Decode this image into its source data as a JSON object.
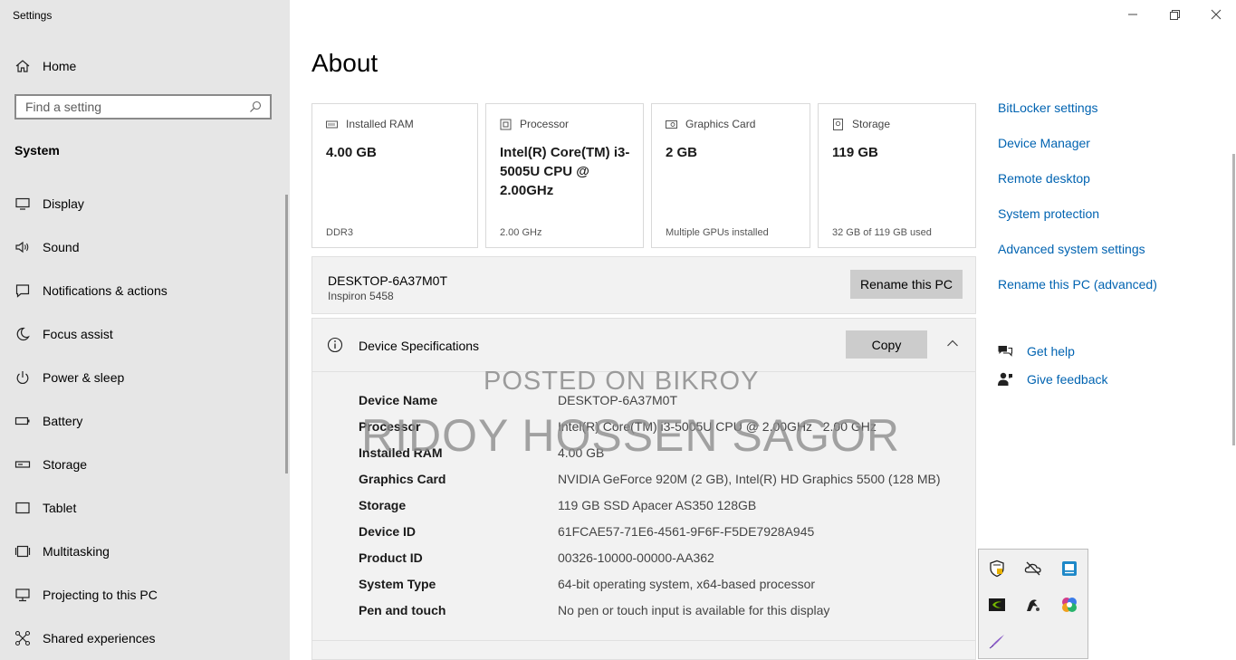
{
  "window": {
    "title": "Settings"
  },
  "sidebar": {
    "home_label": "Home",
    "search_placeholder": "Find a setting",
    "section_title": "System",
    "items": [
      {
        "label": "Display",
        "icon": "monitor-icon"
      },
      {
        "label": "Sound",
        "icon": "speaker-icon"
      },
      {
        "label": "Notifications & actions",
        "icon": "notification-icon"
      },
      {
        "label": "Focus assist",
        "icon": "moon-icon"
      },
      {
        "label": "Power & sleep",
        "icon": "power-icon"
      },
      {
        "label": "Battery",
        "icon": "battery-icon"
      },
      {
        "label": "Storage",
        "icon": "storage-icon"
      },
      {
        "label": "Tablet",
        "icon": "tablet-icon"
      },
      {
        "label": "Multitasking",
        "icon": "multitasking-icon"
      },
      {
        "label": "Projecting to this PC",
        "icon": "projecting-icon"
      },
      {
        "label": "Shared experiences",
        "icon": "shared-experiences-icon"
      }
    ]
  },
  "main": {
    "title": "About",
    "cards": [
      {
        "label": "Installed RAM",
        "value": "4.00 GB",
        "sub": "DDR3",
        "icon": "ram-icon"
      },
      {
        "label": "Processor",
        "value": "Intel(R) Core(TM) i3-5005U CPU @ 2.00GHz",
        "sub": "2.00 GHz",
        "icon": "processor-icon"
      },
      {
        "label": "Graphics Card",
        "value": "2 GB",
        "sub": "Multiple GPUs installed",
        "icon": "graphics-card-icon"
      },
      {
        "label": "Storage",
        "value": "119 GB",
        "sub": "32 GB of 119 GB used",
        "icon": "storage-icon"
      }
    ],
    "pc": {
      "name": "DESKTOP-6A37M0T",
      "model": "Inspiron 5458",
      "rename_button": "Rename this PC"
    },
    "specs": {
      "title": "Device Specifications",
      "copy_button": "Copy",
      "rows": [
        {
          "label": "Device Name",
          "value": "DESKTOP-6A37M0T"
        },
        {
          "label": "Processor",
          "value": "Intel(R) Core(TM) i3-5005U CPU @ 2.00GHz   2.00 GHz"
        },
        {
          "label": "Installed RAM",
          "value": "4.00 GB"
        },
        {
          "label": "Graphics Card",
          "value": "NVIDIA GeForce 920M (2 GB), Intel(R) HD Graphics 5500 (128 MB)"
        },
        {
          "label": "Storage",
          "value": "119 GB SSD Apacer AS350 128GB"
        },
        {
          "label": "Device ID",
          "value": "61FCAE57-71E6-4561-9F6F-F5DE7928A945"
        },
        {
          "label": "Product ID",
          "value": "00326-10000-00000-AA362"
        },
        {
          "label": "System Type",
          "value": "64-bit operating system, x64-based processor"
        },
        {
          "label": "Pen and touch",
          "value": "No pen or touch input is available for this display"
        }
      ]
    }
  },
  "related_links": [
    "BitLocker settings",
    "Device Manager",
    "Remote desktop",
    "System protection",
    "Advanced system settings",
    "Rename this PC (advanced)"
  ],
  "help": {
    "get_help": "Get help",
    "give_feedback": "Give feedback"
  },
  "watermark": {
    "line1": "POSTED ON BIKROY",
    "line2": "RIDOY HOSSEN SAGOR"
  },
  "tray_icons": [
    "security-shield-icon",
    "onedrive-offline-icon",
    "display-app-icon",
    "nvidia-icon",
    "media-app-icon",
    "copilot-icon",
    "pen-icon"
  ],
  "colors": {
    "sidebar_bg": "#e6e6e6",
    "link": "#0063b1",
    "button_bg": "#cccccc",
    "panel_bg": "#f2f2f2"
  }
}
